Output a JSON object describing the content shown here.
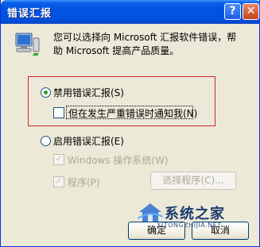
{
  "window": {
    "title": "错误汇报"
  },
  "intro_text": "您可以选择向 Microsoft 汇报软件错误，帮助 Microsoft 提高产品质量。",
  "options": {
    "disable_label": "禁用错误汇报(S)",
    "notify_label": "但在发生严重错误时通知我(N)",
    "enable_label": "启用错误汇报(E)",
    "windows_label": "Windows 操作系统(W)",
    "programs_label": "程序(P)"
  },
  "buttons": {
    "choose_programs": "选择程序(C)...",
    "ok": "确定",
    "cancel": "取消"
  },
  "watermark": {
    "brand": "系统之家",
    "url": "XITONGZHIJIA.NET"
  },
  "colors": {
    "titlebar": "#0054e3",
    "highlight_box": "#d02424",
    "radio_selected": "#21a121"
  },
  "state": {
    "selected_option": "disable",
    "notify_checked": false,
    "windows_checked": true,
    "programs_checked": true
  }
}
